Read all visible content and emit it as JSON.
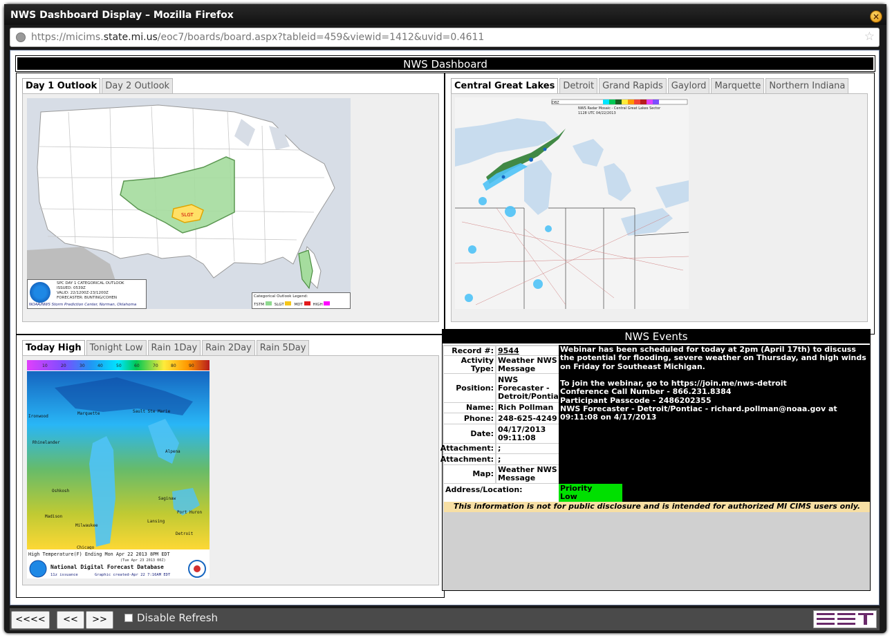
{
  "window": {
    "title": "NWS Dashboard Display – Mozilla Firefox"
  },
  "url": {
    "prefix": "https://micims.",
    "domain": "state.mi.us",
    "path": "/eoc7/boards/board.aspx?tableid=459&viewid=1412&uvid=0.4611"
  },
  "dashboard": {
    "title": "NWS Dashboard"
  },
  "outlook": {
    "tabs": [
      "Day 1 Outlook",
      "Day 2 Outlook"
    ],
    "map": {
      "slgt_label": "SLGT",
      "info_lines": [
        "SPC DAY 1 CATEGORICAL OUTLOOK",
        "ISSUED: 0539Z",
        "VALID: 22/1200Z-23/1200Z",
        "FORECASTER: BUNTING/COHEN"
      ],
      "credit": "NOAA/NWS Storm Prediction Center, Norman, Oklahoma",
      "legend_title": "Categorical Outlook Legend:",
      "legend": [
        {
          "label": "TSTM",
          "color": "#8fd98f"
        },
        {
          "label": "SLGT",
          "color": "#f5c518"
        },
        {
          "label": "MDT",
          "color": "#e31a1c"
        },
        {
          "label": "HIGH",
          "color": "#ff00ff"
        }
      ]
    }
  },
  "radar": {
    "tabs": [
      "Central Great Lakes",
      "Detroit",
      "Grand Rapids",
      "Gaylord",
      "Marquette",
      "Northern Indiana"
    ],
    "map": {
      "bar_label": "DBZ",
      "caption_line1": "NWS Radar Mosaic - Central Great Lakes Sector",
      "caption_line2": "1128 UTC 04/22/2013"
    }
  },
  "forecast": {
    "tabs": [
      "Today High",
      "Tonight Low",
      "Rain 1Day",
      "Rain 2Day",
      "Rain 5Day"
    ],
    "map": {
      "scale_labels": [
        "10",
        "20",
        "30",
        "40",
        "50",
        "60",
        "70",
        "80",
        "90"
      ],
      "caption": "High Temperature(F) Ending Mon Apr 22 2013   8PM EDT",
      "caption2": "(Tue Apr 23 2013 00Z)",
      "db_name": "National Digital Forecast Database",
      "issuance": "11z issuance",
      "created": "Graphic created-Apr 22  7:16AM EDT",
      "cities": [
        "Ironwood",
        "Marquette",
        "Sault Ste Marie",
        "Rhinelander",
        "Alpena",
        "Oshkosh",
        "Saginaw",
        "Madison",
        "Milwaukee",
        "Lansing",
        "Port Huron",
        "Detroit",
        "Chicago"
      ]
    }
  },
  "events": {
    "title": "NWS Events",
    "rows": [
      {
        "label": "Record #:",
        "value": "9544"
      },
      {
        "label": "Activity Type:",
        "value": "Weather NWS Message"
      },
      {
        "label": "Position:",
        "value": "NWS Forecaster - Detroit/Pontiac"
      },
      {
        "label": "Name:",
        "value": "Rich Pollman"
      },
      {
        "label": "Phone:",
        "value": "248-625-4249"
      },
      {
        "label": "Date:",
        "value": "04/17/2013 09:11:08"
      },
      {
        "label": "Attachment:",
        "value": ";"
      },
      {
        "label": "Attachment:",
        "value": ";"
      },
      {
        "label": "Map:",
        "value": "Weather NWS Message"
      }
    ],
    "message": "Webinar has been scheduled for today at 2pm (April 17th) to discuss the potential for flooding, severe weather on Thursday, and high winds on Friday for Southeast Michigan.\n\nTo join the webinar, go to https://join.me/nws-detroit\nConference Call Number - 866.231.8384\nParticipant Passcode - 2486202355\nNWS Forecaster - Detroit/Pontiac - richard.pollman@noaa.gov at 09:11:08 on 4/17/2013",
    "address_label": "Address/Location:",
    "priority": "Priority",
    "priority_value": "Low",
    "disclaimer": "This information is not for public disclosure and is intended for authorized MI CIMS users only."
  },
  "bottom": {
    "first": "<<<<",
    "prev": "<<",
    "next": ">>",
    "refresh_label": "Disable Refresh"
  }
}
